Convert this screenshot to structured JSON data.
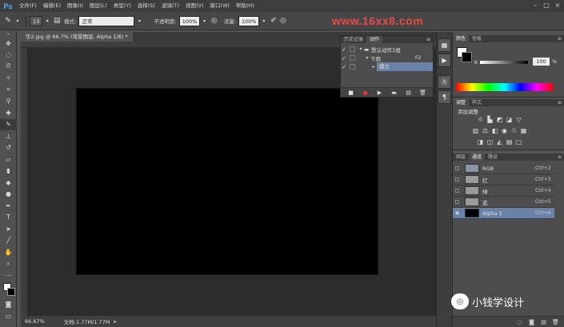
{
  "app": {
    "logo": "Ps"
  },
  "menu": [
    "文件(F)",
    "编辑(E)",
    "图像(I)",
    "图层(L)",
    "类型(Y)",
    "选择(S)",
    "滤镜(T)",
    "视图(V)",
    "窗口(W)",
    "帮助(H)"
  ],
  "window_controls": [
    "minimize-icon",
    "maximize-icon",
    "close-icon"
  ],
  "options_bar": {
    "brush_size": "13",
    "mode_label": "模式:",
    "mode_value": "正常",
    "opacity_label": "不透明度:",
    "opacity_value": "100%",
    "flow_label": "流量:",
    "flow_value": "100%"
  },
  "watermark": "www.16xx8.com",
  "document": {
    "tab_title": "华2.jpg @ 66.7% (背景图层, Alpha 1/8) *",
    "zoom": "66.67%",
    "doc_info": "文档:1.77M/1.77M",
    "canvas_color": "#000000"
  },
  "actions_panel": {
    "tabs": [
      "历史记录",
      "动作"
    ],
    "rows": [
      {
        "label": "默认动作1组",
        "shortcut": ""
      },
      {
        "label": "下雨",
        "shortcut": "F2"
      },
      {
        "label": "建立",
        "shortcut": ""
      }
    ]
  },
  "color_panel": {
    "tabs": [
      "颜色",
      "色板"
    ],
    "channel_label": "K",
    "value": "100",
    "unit": "%"
  },
  "adjust_panel": {
    "tabs": [
      "调整",
      "样式"
    ],
    "title": "添加调整"
  },
  "channels_panel": {
    "tabs": [
      "图层",
      "通道",
      "路径"
    ],
    "rows": [
      {
        "name": "RGB",
        "shortcut": "Ctrl+2"
      },
      {
        "name": "红",
        "shortcut": "Ctrl+3"
      },
      {
        "name": "绿",
        "shortcut": "Ctrl+4"
      },
      {
        "name": "蓝",
        "shortcut": "Ctrl+5"
      },
      {
        "name": "Alpha 1",
        "shortcut": "Ctrl+6"
      }
    ]
  },
  "brand": {
    "text": "小钱学设计"
  }
}
